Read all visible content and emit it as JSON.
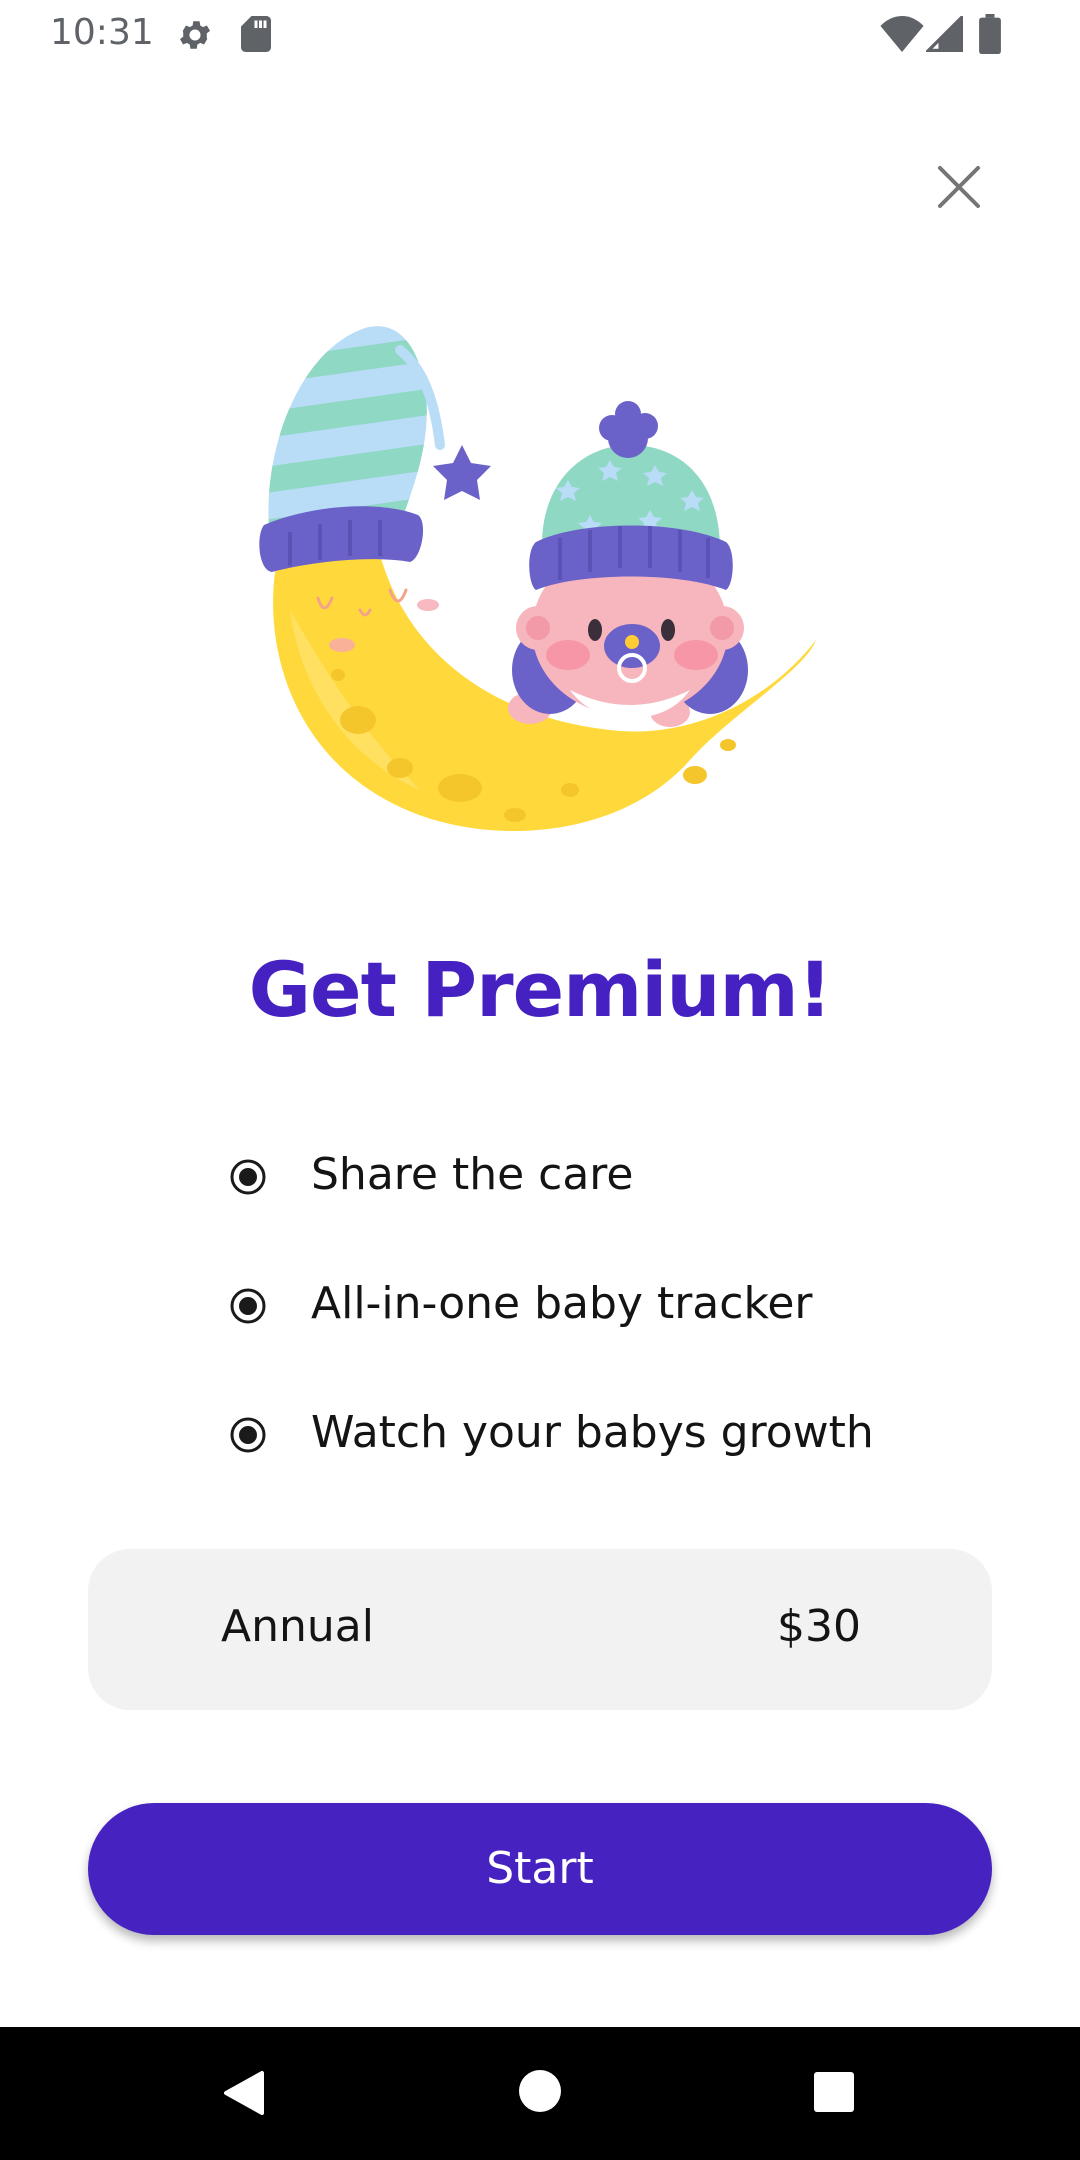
{
  "status_bar": {
    "time": "10:31",
    "icons": [
      "gear-icon",
      "sd-card-icon",
      "wifi-icon",
      "cell-signal-icon",
      "battery-icon"
    ]
  },
  "close_icon": "close-icon",
  "title": "Get Premium!",
  "features": [
    {
      "label": "Share the care",
      "icon": "radio-selected-icon"
    },
    {
      "label": "All-in-one baby tracker",
      "icon": "radio-selected-icon"
    },
    {
      "label": "Watch your babys growth",
      "icon": "radio-selected-icon"
    }
  ],
  "plan": {
    "name": "Annual",
    "price": "$30"
  },
  "start_button": {
    "label": "Start"
  },
  "nav_bar": {
    "icons": [
      "back-icon",
      "home-icon",
      "recents-icon"
    ]
  },
  "colors": {
    "accent": "#4622c1",
    "title": "#4521c2",
    "card_bg": "#f2f2f2",
    "moon": "#ffd93b",
    "hat_stripe_light": "#b9dcf7",
    "hat_stripe_teal": "#8fd8c4",
    "hat_band": "#6a62c8",
    "baby_skin": "#f7b5bd"
  }
}
